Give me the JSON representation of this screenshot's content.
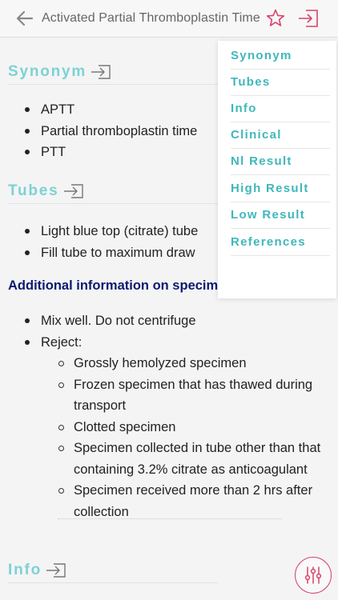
{
  "header": {
    "title": "Activated Partial Thromboplastin Time"
  },
  "colors": {
    "accent": "#7dd2d2",
    "toc_text": "#3fb7bb",
    "brand_red": "#d9436b",
    "subheading": "#0d1a6e"
  },
  "icons": {
    "back": "arrow-left-icon",
    "favorite": "star-icon",
    "jump": "sign-in-icon",
    "settings": "sliders-icon"
  },
  "sections": {
    "synonym": {
      "label": "Synonym",
      "items": [
        "APTT",
        "Partial thromboplastin time",
        "PTT"
      ]
    },
    "tubes": {
      "label": "Tubes",
      "items": [
        "Light blue top (citrate) tube",
        "Fill tube to maximum draw"
      ]
    },
    "additional": {
      "heading": "Additional information on specimen collection:",
      "items": [
        "Mix well. Do not centrifuge",
        "Reject:"
      ],
      "reject_items": [
        "Grossly hemolyzed specimen",
        "Frozen specimen that has thawed during transport",
        "Clotted specimen",
        "Specimen collected in tube other than that containing 3.2% citrate as anticoagulant",
        "Specimen received more than 2 hrs after collection"
      ]
    },
    "info": {
      "label": "Info"
    }
  },
  "toc": {
    "items": [
      "Synonym",
      "Tubes",
      "Info",
      "Clinical",
      "Nl Result",
      "High Result",
      "Low Result",
      "References"
    ]
  }
}
